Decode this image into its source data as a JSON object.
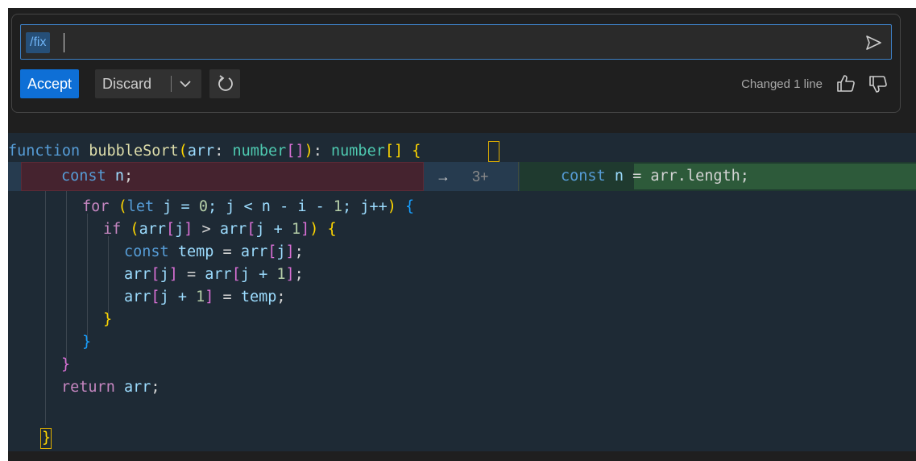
{
  "chat": {
    "slash_command": "/fix",
    "input_value": "",
    "accept_label": "Accept",
    "discard_label": "Discard",
    "status_text": "Changed 1 line",
    "icons": {
      "send": "send-icon",
      "dropdown": "chevron-down-icon",
      "rerun": "refresh-icon",
      "thumbs_up": "thumbs-up-icon",
      "thumbs_down": "thumbs-down-icon"
    }
  },
  "colors": {
    "accent": "#0e6fd6",
    "deleted_bg": "#45232f",
    "inserted_bg": "#2d5a3a"
  },
  "editor": {
    "line1": {
      "kw": "function",
      "name": "bubbleSort",
      "p1": "(",
      "param": "arr",
      "colon": ": ",
      "type1": "number",
      "br1": "[]",
      "p2": ")",
      "colon2": ": ",
      "type2": "number",
      "br2": "[]",
      "sp": " ",
      "brace": "{"
    },
    "line2_old": {
      "kw": "const",
      "var": "n",
      "semi": ";"
    },
    "diff_arrow": "→",
    "diff_linenum": "3+",
    "line2_new": {
      "kw": "const",
      "var": "n",
      "rest": " = arr.length;"
    },
    "line3": {
      "kw": "for",
      "open": "(",
      "let": "let",
      "body": " j = ",
      "zero": "0",
      "mid": "; j < n - i - ",
      "one": "1",
      "end": "; j++",
      "close": ")",
      "brace": "{"
    },
    "line4": {
      "kw": "if",
      "open": "(",
      "a": "arr",
      "b1": "[",
      "j": "j",
      "b2": "]",
      "gt": " > ",
      "a2": "arr",
      "b3": "[",
      "j2": "j + ",
      "one": "1",
      "b4": "]",
      "close": ")",
      "brace": "{"
    },
    "line5": {
      "kw": "const",
      "name": "temp",
      "eq": " = ",
      "a": "arr",
      "b1": "[",
      "j": "j",
      "b2": "]",
      "semi": ";"
    },
    "line6": {
      "a": "arr",
      "b1": "[",
      "j": "j",
      "b2": "]",
      "eq": " = ",
      "a2": "arr",
      "b3": "[",
      "j2": "j + ",
      "one": "1",
      "b4": "]",
      "semi": ";"
    },
    "line7": {
      "a": "arr",
      "b1": "[",
      "j": "j + ",
      "one": "1",
      "b2": "]",
      "eq": " = ",
      "v": "temp",
      "semi": ";"
    },
    "line8": {
      "brace": "}"
    },
    "line9": {
      "brace": "}"
    },
    "line10": {
      "brace": "}"
    },
    "line11": {
      "kw": "return",
      "v": "arr",
      "semi": ";"
    },
    "line12": {
      "brace": "}"
    }
  }
}
